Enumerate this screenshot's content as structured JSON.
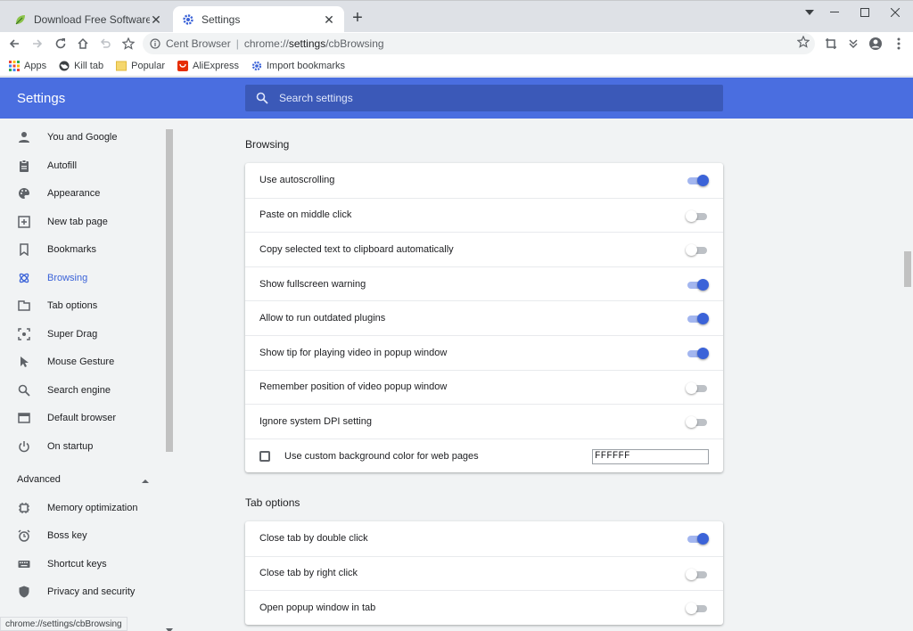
{
  "tabs": [
    {
      "title": "Download Free Software for Win",
      "active": false,
      "icon": "leaf-icon"
    },
    {
      "title": "Settings",
      "active": true,
      "icon": "gear-icon"
    }
  ],
  "toolbar": {
    "url_prefix": "Cent Browser",
    "url_scheme": "chrome://",
    "url_host": "settings",
    "url_path": "/cbBrowsing"
  },
  "bookmarks": [
    {
      "label": "Apps",
      "icon": "apps-grid-icon"
    },
    {
      "label": "Kill tab",
      "icon": "globe-icon"
    },
    {
      "label": "Popular",
      "icon": "folder-icon"
    },
    {
      "label": "AliExpress",
      "icon": "aliexpress-icon"
    },
    {
      "label": "Import bookmarks",
      "icon": "gear-icon"
    }
  ],
  "header": {
    "title": "Settings",
    "search_placeholder": "Search settings"
  },
  "sidebar": {
    "items": [
      {
        "label": "You and Google",
        "icon": "person-icon"
      },
      {
        "label": "Autofill",
        "icon": "clipboard-icon"
      },
      {
        "label": "Appearance",
        "icon": "palette-icon"
      },
      {
        "label": "New tab page",
        "icon": "new-tab-icon"
      },
      {
        "label": "Bookmarks",
        "icon": "bookmark-icon"
      },
      {
        "label": "Browsing",
        "icon": "atom-icon",
        "active": true
      },
      {
        "label": "Tab options",
        "icon": "tab-icon"
      },
      {
        "label": "Super Drag",
        "icon": "drag-icon"
      },
      {
        "label": "Mouse Gesture",
        "icon": "cursor-icon"
      },
      {
        "label": "Search engine",
        "icon": "search-icon"
      },
      {
        "label": "Default browser",
        "icon": "browser-window-icon"
      },
      {
        "label": "On startup",
        "icon": "power-icon"
      }
    ],
    "advanced_label": "Advanced",
    "advanced_items": [
      {
        "label": "Memory optimization",
        "icon": "chip-icon"
      },
      {
        "label": "Boss key",
        "icon": "alarm-icon"
      },
      {
        "label": "Shortcut keys",
        "icon": "keyboard-icon"
      },
      {
        "label": "Privacy and security",
        "icon": "shield-icon"
      }
    ]
  },
  "browsing": {
    "title": "Browsing",
    "rows": [
      {
        "label": "Use autoscrolling",
        "on": true
      },
      {
        "label": "Paste on middle click",
        "on": false
      },
      {
        "label": "Copy selected text to clipboard automatically",
        "on": false
      },
      {
        "label": "Show fullscreen warning",
        "on": true
      },
      {
        "label": "Allow to run outdated plugins",
        "on": true
      },
      {
        "label": "Show tip for playing video in popup window",
        "on": true
      },
      {
        "label": "Remember position of video popup window",
        "on": false
      },
      {
        "label": "Ignore system DPI setting",
        "on": false
      }
    ],
    "custom_bg_label": "Use custom background color for web pages",
    "custom_bg_value": "FFFFFF"
  },
  "tab_options": {
    "title": "Tab options",
    "rows": [
      {
        "label": "Close tab by double click",
        "on": true
      },
      {
        "label": "Close tab by right click",
        "on": false
      },
      {
        "label": "Open popup window in tab",
        "on": false
      }
    ]
  },
  "status": "chrome://settings/cbBrowsing",
  "colors": {
    "accent": "#3b63d8",
    "header": "#4a6ee0",
    "search_bg": "#3b59b8"
  }
}
